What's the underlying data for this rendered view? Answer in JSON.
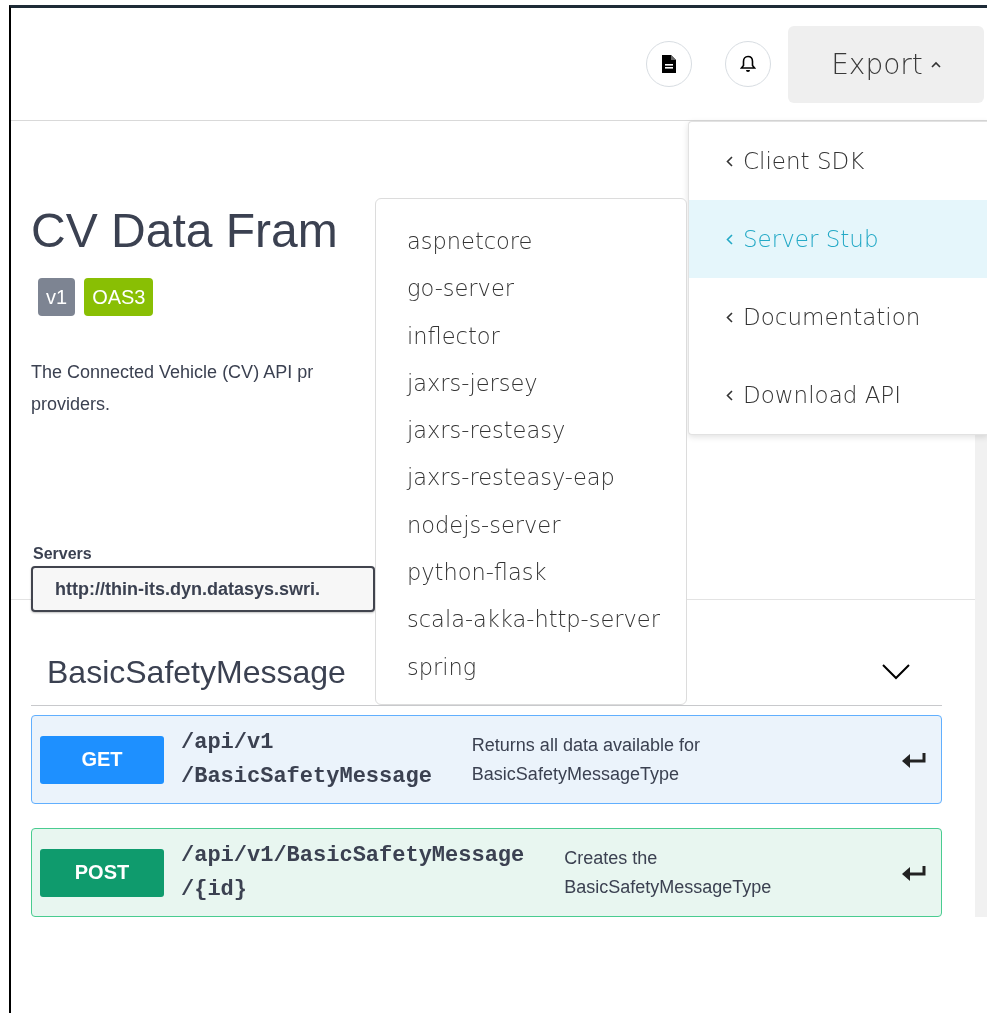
{
  "export_button": {
    "label": "Export",
    "expanded": true
  },
  "export_menu": [
    {
      "label": "Client SDK",
      "selected": false
    },
    {
      "label": "Server Stub",
      "selected": true
    },
    {
      "label": "Documentation",
      "selected": false
    },
    {
      "label": "Download API",
      "selected": false
    }
  ],
  "server_stub_menu": [
    "aspnetcore",
    "go-server",
    "inflector",
    "jaxrs-jersey",
    "jaxrs-resteasy",
    "jaxrs-resteasy-eap",
    "nodejs-server",
    "python-flask",
    "scala-akka-http-server",
    "spring"
  ],
  "info": {
    "title": "CV Data Fram",
    "badges": [
      {
        "label": "v1",
        "color": "#7d8492"
      },
      {
        "label": "OAS3",
        "color": "#89bf04"
      }
    ],
    "description": "The Connected Vehicle (CV) API pr\nproviders."
  },
  "servers": {
    "label": "Servers",
    "value": "http://thin-its.dyn.datasys.swri."
  },
  "tag": {
    "name": "BasicSafetyMessage",
    "expanded": true,
    "operations": [
      {
        "kind": "get",
        "method": "GET",
        "path": "/api/v1\n/BasicSafetyMessage",
        "summary": "Returns all data available for\nBasicSafetyMessageType"
      },
      {
        "kind": "post",
        "method": "POST",
        "path": "/api/v1/BasicSafetyMessage\n/{id}",
        "summary": "Creates the\nBasicSafetyMessageType"
      }
    ]
  }
}
